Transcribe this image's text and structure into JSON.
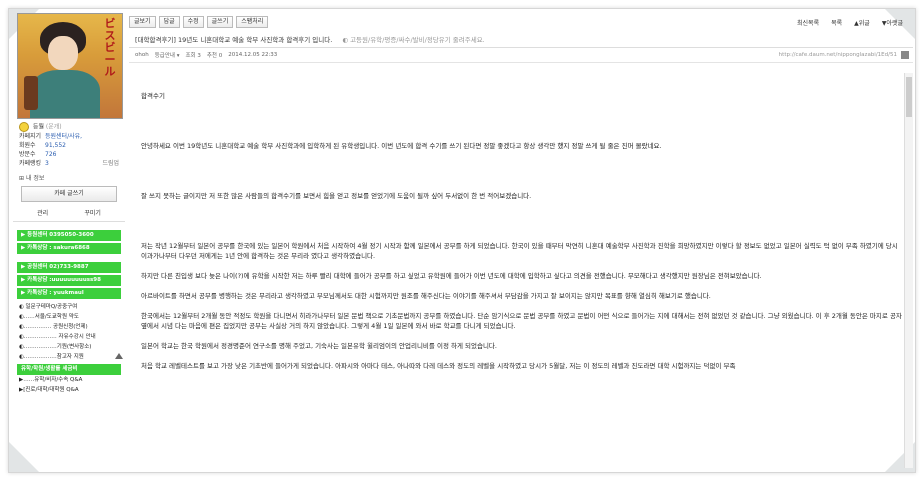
{
  "sidebar": {
    "poster_text": "ビスビール",
    "nickname": "등월",
    "nickname_tag": "(운개)",
    "profile": [
      {
        "k": "카페지기",
        "v": "등원센터/사유,",
        "v2": ""
      },
      {
        "k": "회원수",
        "v": "91,552",
        "v2": ""
      },
      {
        "k": "방문수",
        "v": "726",
        "v2": ""
      },
      {
        "k": "카페랭킹",
        "v": "3",
        "v2": "드림업"
      }
    ],
    "my_info": "내 정보",
    "write_button": "카페 글쓰기",
    "admin": [
      "관리",
      "꾸미기"
    ],
    "green_group1": [
      "▶ 등원센터 0395050-3600",
      "▶ 카톡상담 : sakura6868"
    ],
    "green_group2": [
      "▶ 공원센터 02)733-9887",
      "▶ 카톡상담 :uuuuuuuuuss98",
      "▶ 카톡상담 : yuukmaul"
    ],
    "menu_links": [
      "◐ 일문구테마Q/공중구여",
      "◐……서울/도쿄학원 약도",
      "◐…………… 공원신청(언제)",
      "◐……………… 자유수강시 안내",
      "◐………………기원(변사항소)",
      "◐………………참고자 지원"
    ],
    "green_group3": "유학/학원/생활를 세금비",
    "bottom_links": [
      "▶……유학/비자/수속 Q&A",
      "▶[진로/대학/대학원 Q&A"
    ]
  },
  "toolbar": {
    "buttons": [
      "글보기",
      "답글",
      "수정",
      "글쓰기",
      "스팸처리"
    ],
    "right": [
      "최신목록",
      "목록",
      "▲위글",
      "▼아랫글"
    ]
  },
  "post": {
    "title": "[대학합격후기] 19년도 니혼대학교 예술 학부 사진학과 합격후기 입니다.",
    "tags": "고등원/유학/평증/싸수/발비/정당유기 줄려주세요.",
    "author": "ohoh",
    "grade": "등급안내 ▾",
    "views": "조회 3",
    "comments": "추천 0",
    "date": "2014.12.05 22:33",
    "url": "http://cafe.daum.net/nipponglazabi/1Ed/51"
  },
  "content": [
    "합격수기",
    "안녕하세요 이번 19학년도 니혼대학교 예술 학부 사진학과에 입학하게 된 유학생입니다. 이번 년도에 합격 수기를 쓰기 된다면 정말 좋겠다고 항상 생각만 했지 정말 쓰게 될 줄은 진머 몰랐네요.",
    "잘 쓰지 못하는 글이지만 저 또한 많은 사람들의 합격수기를 보면서 힘을 얻고 정보를 얻었기에 도움이 될까 싶어 두서없이 한 번 적어보겠습니다.",
    "저는 작년 12월부터 일본어 공부를 한국에 있는 일본어 학원에서 처음 시작하여 4월 정기 시작과 함께 일본에서 공부를 하게 되었습니다. 한국이 있을 때부터 막연히 니혼대 예술학부 사진학과 진학을 희망하였지만 이렇다 할 정보도 없었고 일본어 실력도 턱 없이 부족 하였기에 당시 이과가나부터 다우던 저에게는 1년 안에 합격하는 것은 무리라 였다고 생각하였습니다.",
    "하지만 다른 친입생 보다 늦은 나이(?)에 유학을 시작한 저는 하루 빨리 대학에 들어가 공부를 하고 싶었고 유학원에 들어가 이번 년도에 대학에 입학하고 싶다고 의견을 전했습니다. 무모해다고 생각했지만 원장님은 전혀보았습니다.",
    "아르바이트를 하면서 공부를 병행하는 것은 무리라고 생각하였고 부모님께서도 대한 시험까지만 원조를 해주신다는 이야기를 해주셔서 부담감을 가지고 잘 보이지는 않지만 목표를 향해 열심히 해보기로 했습니다.",
    "한국에서는 12월부터 2개월 동안 적정도 학원을 다니면서 히라가나부터 일본 문법 책으로 기초문법까지 공부를 하였습니다. 단순 암기식으로 문법 공부를 하였고 문법이 어떤 식으로 들어가는 지에 대해서는 전혀 없었던 것 같습니다. 그냥 외웠습니다. 이 후 2개월 동안은 마지로 공자 옆에서 시념 다는 마음에 편은 집었지만 공부는 사실상 거의 하지 않았습니다. 그렇게 4월 1일 일본에 와서 바로 학교를 다니게 되었습니다.",
    "일본어 학교는 한국 학원에서 정경명준어 연구소를 명해 주었고, 기숙사는 일본유학 윌리엄이의 안업리니비를 이정 하게 되었습니다.",
    "처음 학교 레벨테스트를 보고 가장 낮은 기초반에 들어가게 되었습니다. 아파시와 아마다 테스, 아나따와 다레 데스와 정도의 레벨을 시작하였고 당시가 5월달, 저는 이 정도의 레벨과 진도라면 대학 시험까지는 덕없이 부족"
  ]
}
